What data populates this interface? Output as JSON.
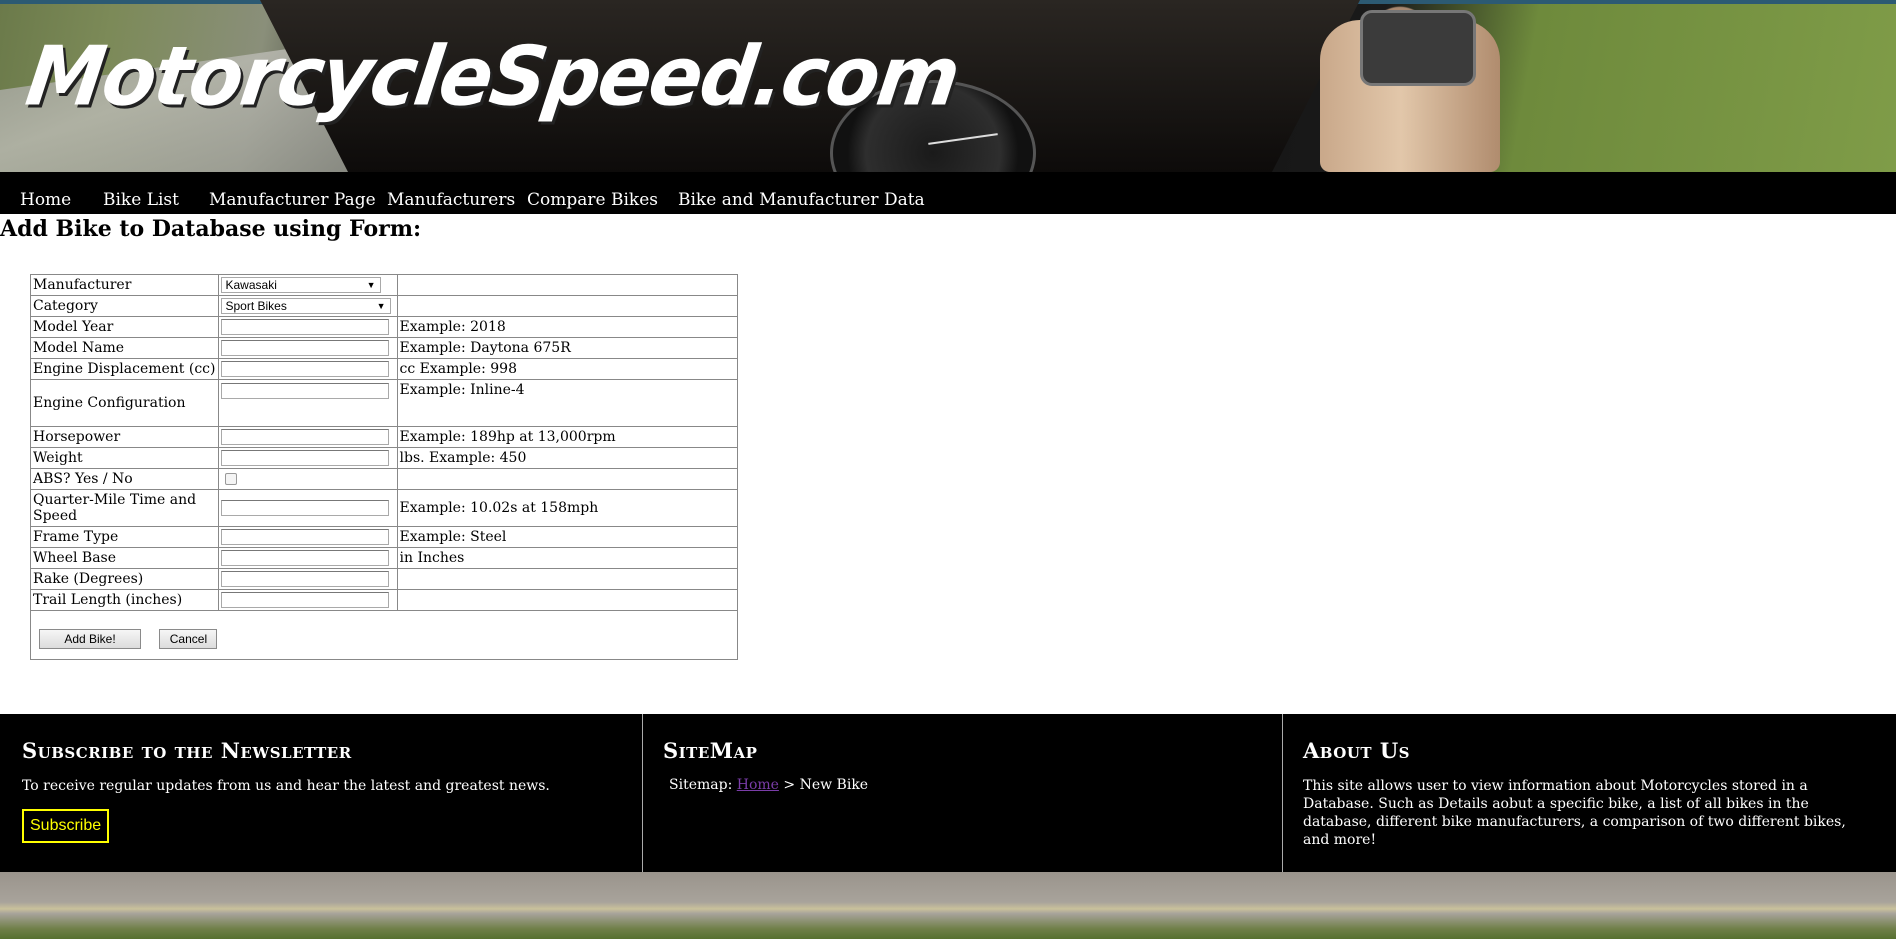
{
  "header": {
    "logo_text": "MotorcycleSpeed.com"
  },
  "nav": {
    "items": [
      {
        "label": "Home"
      },
      {
        "label": "Bike List"
      },
      {
        "label": "Manufacturer Page"
      },
      {
        "label": "Manufacturers"
      },
      {
        "label": "Compare Bikes"
      },
      {
        "label": "Bike and Manufacturer Data"
      }
    ]
  },
  "page": {
    "heading": "Add Bike to Database using Form:"
  },
  "form": {
    "manufacturer": {
      "label": "Manufacturer",
      "selected": "Kawasaki"
    },
    "category": {
      "label": "Category",
      "selected": "Sport Bikes"
    },
    "model_year": {
      "label": "Model Year",
      "value": "",
      "note": "Example: 2018"
    },
    "model_name": {
      "label": "Model Name",
      "value": "",
      "note": "Example: Daytona 675R"
    },
    "engine_displacement": {
      "label": "Engine Displacement (cc)",
      "value": "",
      "note": "cc Example: 998"
    },
    "engine_configuration": {
      "label": "Engine Configuration",
      "value": "",
      "note": "Example: Inline-4"
    },
    "horsepower": {
      "label": "Horsepower",
      "value": "",
      "note": "Example: 189hp at 13,000rpm"
    },
    "weight": {
      "label": "Weight",
      "value": "",
      "note": "lbs. Example: 450"
    },
    "abs": {
      "label": "ABS? Yes / No",
      "checked": false
    },
    "quarter_mile": {
      "label": "Quarter-Mile Time and Speed",
      "value": "",
      "note": "Example: 10.02s at 158mph"
    },
    "frame_type": {
      "label": "Frame Type",
      "value": "",
      "note": "Example: Steel"
    },
    "wheel_base": {
      "label": "Wheel Base",
      "value": "",
      "note": "in Inches"
    },
    "rake": {
      "label": "Rake (Degrees)",
      "value": ""
    },
    "trail_length": {
      "label": "Trail Length (inches)",
      "value": ""
    },
    "submit_label": "Add Bike!",
    "cancel_label": "Cancel"
  },
  "footer": {
    "newsletter": {
      "title": "Subscribe to the Newsletter",
      "text": "To receive regular updates from us and hear the latest and greatest news.",
      "button_label": "Subscribe"
    },
    "sitemap": {
      "title": "SiteMap",
      "prefix": "Sitemap:",
      "home_link": "Home",
      "separator": ">",
      "current": "New Bike"
    },
    "about": {
      "title": "About Us",
      "text": "This site allows user to view information about Motorcycles stored in a Database. Such as Details aobut a specific bike, a list of all bikes in the database, different bike manufacturers, a comparison of two different bikes, and more!"
    }
  },
  "colors": {
    "nav_bg": "#000000",
    "footer_bg": "#000000",
    "subscribe_accent": "#ffff00",
    "visited_link": "#7a3da8"
  }
}
